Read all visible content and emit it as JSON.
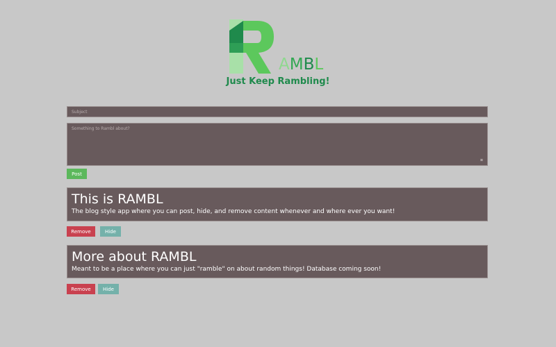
{
  "logo": {
    "letters": [
      "A",
      "M",
      "B",
      "L"
    ],
    "letter_colors": [
      "#8fd88f",
      "#33a853",
      "#1f8a4c",
      "#5cc85c"
    ],
    "tagline": "Just Keep Rambling!",
    "colors": {
      "dark_green": "#1f8a4c",
      "mid_green": "#5cc85c",
      "light_green": "#a8e0a8"
    }
  },
  "form": {
    "subject_placeholder": "Subject",
    "body_placeholder": "Something to Rambl about?",
    "post_label": "Post",
    "resize_icon": "resize-grip-icon"
  },
  "posts": [
    {
      "title": "This is RAMBL",
      "body": "The blog style app where you can post, hide, and remove content whenever and where ever you want!",
      "remove_label": "Remove",
      "hide_label": "Hide"
    },
    {
      "title": "More about RAMBL",
      "body": "Meant to be a place where you can just \"ramble\" on about random things! Database coming soon!",
      "remove_label": "Remove",
      "hide_label": "Hide"
    }
  ],
  "theme": {
    "background": "#c8c8c8",
    "card": "#685a5c",
    "post_button": "#5cb85c",
    "remove_button": "#c9414f",
    "hide_button": "#74b1aa"
  }
}
